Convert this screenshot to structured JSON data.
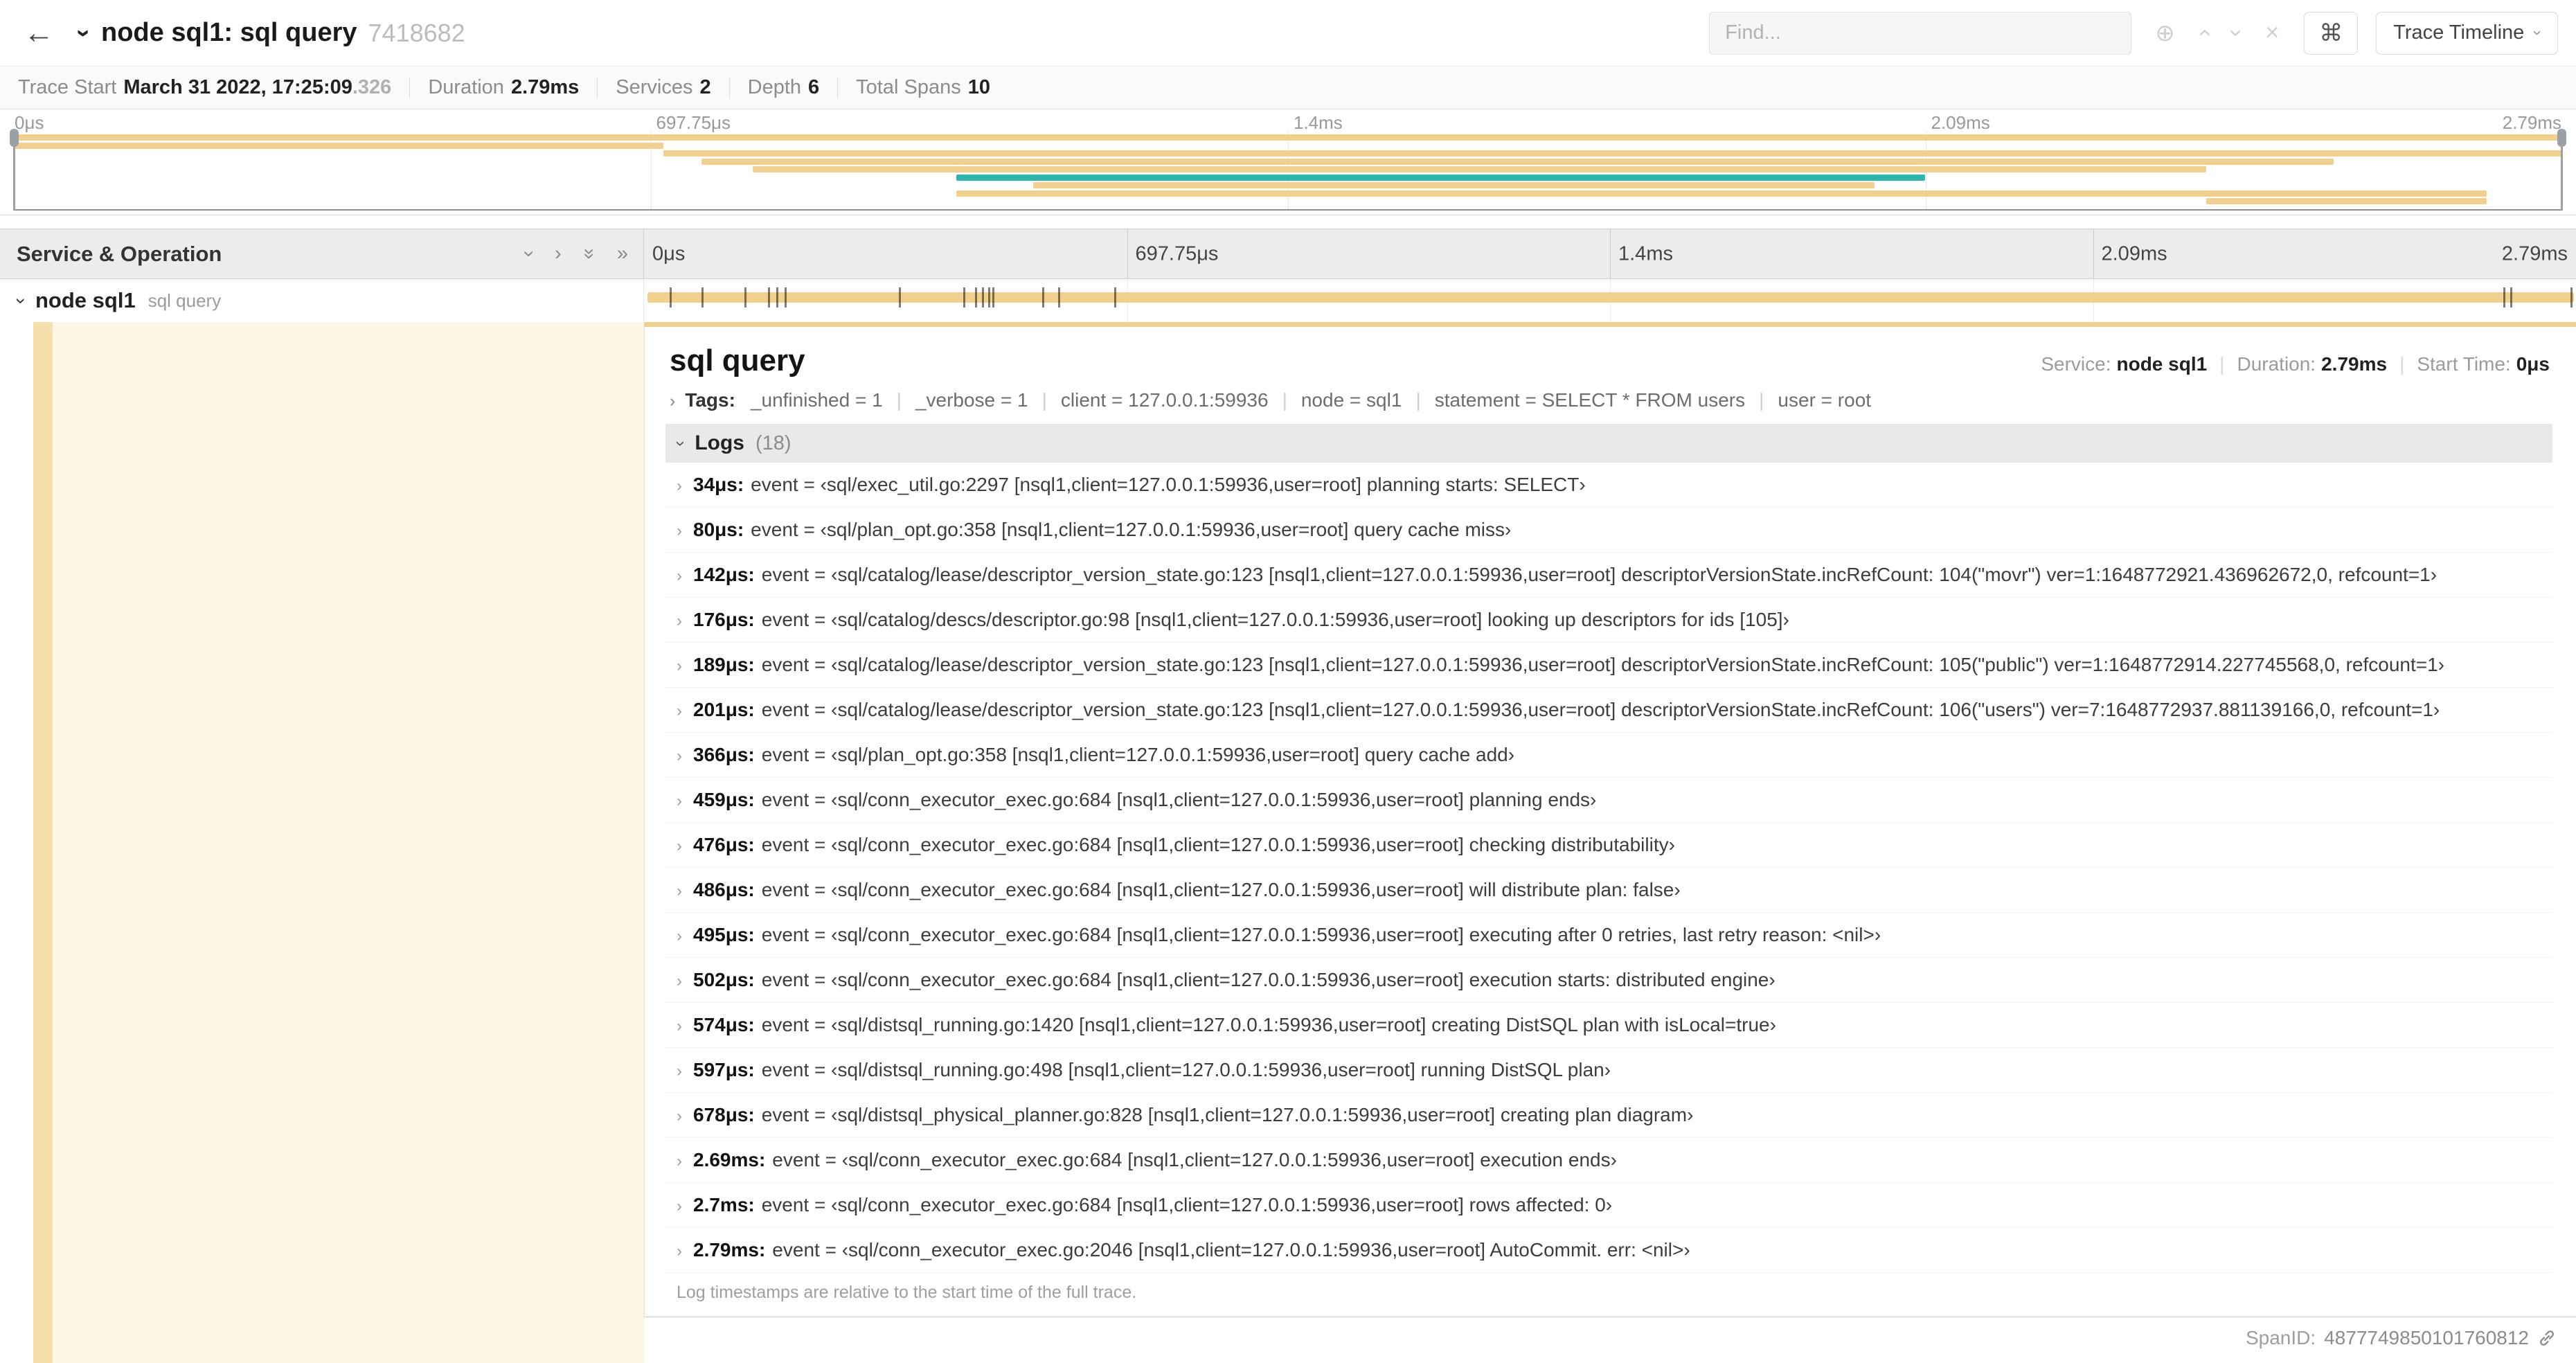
{
  "icons": {
    "back": "←",
    "chevron": "›",
    "double_chevron": "»",
    "locate": "⊕",
    "clear": "×",
    "command": "⌘"
  },
  "colors": {
    "tan": "#F0D08C",
    "tan_strip": "#F5E0AC",
    "tan_tint": "#FDF6E4",
    "teal": "#2EB6AA"
  },
  "topbar": {
    "title": "node sql1: sql query",
    "trace_id": "7418682",
    "find_placeholder": "Find...",
    "view_button": "Trace Timeline"
  },
  "infobar": {
    "items": [
      {
        "label": "Trace Start",
        "value": "March 31 2022, 17:25:09",
        "extra": ".326"
      },
      {
        "label": "Duration",
        "value": "2.79ms",
        "extra": ""
      },
      {
        "label": "Services",
        "value": "2",
        "extra": ""
      },
      {
        "label": "Depth",
        "value": "6",
        "extra": ""
      },
      {
        "label": "Total Spans",
        "value": "10",
        "extra": ""
      }
    ]
  },
  "timeline": {
    "header_left": "Service & Operation",
    "ticks": [
      {
        "label": "0μs",
        "pct": 0
      },
      {
        "label": "697.75μs",
        "pct": 25
      },
      {
        "label": "1.4ms",
        "pct": 50
      },
      {
        "label": "2.09ms",
        "pct": 75
      },
      {
        "label": "2.79ms",
        "pct": 100
      }
    ]
  },
  "minimap": {
    "spans": [
      {
        "row": 0,
        "start": 0,
        "end": 100,
        "color": "tan"
      },
      {
        "row": 1,
        "start": 0,
        "end": 25.5,
        "color": "tan"
      },
      {
        "row": 2,
        "start": 25.5,
        "end": 100,
        "color": "tan"
      },
      {
        "row": 3,
        "start": 27,
        "end": 91,
        "color": "tan"
      },
      {
        "row": 4,
        "start": 29,
        "end": 86,
        "color": "tan"
      },
      {
        "row": 5,
        "start": 37,
        "end": 75,
        "color": "teal"
      },
      {
        "row": 6,
        "start": 40,
        "end": 73,
        "color": "tan"
      },
      {
        "row": 7,
        "start": 37,
        "end": 97,
        "color": "tan"
      },
      {
        "row": 8,
        "start": 86,
        "end": 97,
        "color": "tan"
      }
    ]
  },
  "span": {
    "service": "node sql1",
    "operation": "sql query"
  },
  "detail": {
    "title": "sql query",
    "meta": {
      "service_label": "Service:",
      "service_value": "node sql1",
      "duration_label": "Duration:",
      "duration_value": "2.79ms",
      "start_label": "Start Time:",
      "start_value": "0μs"
    },
    "tags_label": "Tags:",
    "tags": [
      {
        "key": "_unfinished",
        "value": "1"
      },
      {
        "key": "_verbose",
        "value": "1"
      },
      {
        "key": "client",
        "value": "127.0.0.1:59936"
      },
      {
        "key": "node",
        "value": "sql1"
      },
      {
        "key": "statement",
        "value": "SELECT * FROM users"
      },
      {
        "key": "user",
        "value": "root"
      }
    ],
    "logs_title": "Logs",
    "logs_count": "(18)",
    "logs": [
      {
        "time": "34μs:",
        "pct": 1.22,
        "text": "event = ‹sql/exec_util.go:2297 [nsql1,client=127.0.0.1:59936,user=root] planning starts: SELECT›"
      },
      {
        "time": "80μs:",
        "pct": 2.87,
        "text": "event = ‹sql/plan_opt.go:358 [nsql1,client=127.0.0.1:59936,user=root] query cache miss›"
      },
      {
        "time": "142μs:",
        "pct": 5.09,
        "text": "event = ‹sql/catalog/lease/descriptor_version_state.go:123 [nsql1,client=127.0.0.1:59936,user=root] descriptorVersionState.incRefCount: 104(\"movr\") ver=1:1648772921.436962672,0, refcount=1›"
      },
      {
        "time": "176μs:",
        "pct": 6.31,
        "text": "event = ‹sql/catalog/descs/descriptor.go:98 [nsql1,client=127.0.0.1:59936,user=root] looking up descriptors for ids [105]›"
      },
      {
        "time": "189μs:",
        "pct": 6.77,
        "text": "event = ‹sql/catalog/lease/descriptor_version_state.go:123 [nsql1,client=127.0.0.1:59936,user=root] descriptorVersionState.incRefCount: 105(\"public\") ver=1:1648772914.227745568,0, refcount=1›"
      },
      {
        "time": "201μs:",
        "pct": 7.2,
        "text": "event = ‹sql/catalog/lease/descriptor_version_state.go:123 [nsql1,client=127.0.0.1:59936,user=root] descriptorVersionState.incRefCount: 106(\"users\") ver=7:1648772937.881139166,0, refcount=1›"
      },
      {
        "time": "366μs:",
        "pct": 13.12,
        "text": "event = ‹sql/plan_opt.go:358 [nsql1,client=127.0.0.1:59936,user=root] query cache add›"
      },
      {
        "time": "459μs:",
        "pct": 16.45,
        "text": "event = ‹sql/conn_executor_exec.go:684 [nsql1,client=127.0.0.1:59936,user=root] planning ends›"
      },
      {
        "time": "476μs:",
        "pct": 17.06,
        "text": "event = ‹sql/conn_executor_exec.go:684 [nsql1,client=127.0.0.1:59936,user=root] checking distributability›"
      },
      {
        "time": "486μs:",
        "pct": 17.42,
        "text": "event = ‹sql/conn_executor_exec.go:684 [nsql1,client=127.0.0.1:59936,user=root] will distribute plan: false›"
      },
      {
        "time": "495μs:",
        "pct": 17.74,
        "text": "event = ‹sql/conn_executor_exec.go:684 [nsql1,client=127.0.0.1:59936,user=root] executing after 0 retries, last retry reason: <nil>›"
      },
      {
        "time": "502μs:",
        "pct": 17.99,
        "text": "event = ‹sql/conn_executor_exec.go:684 [nsql1,client=127.0.0.1:59936,user=root] execution starts: distributed engine›"
      },
      {
        "time": "574μs:",
        "pct": 20.57,
        "text": "event = ‹sql/distsql_running.go:1420 [nsql1,client=127.0.0.1:59936,user=root] creating DistSQL plan with isLocal=true›"
      },
      {
        "time": "597μs:",
        "pct": 21.4,
        "text": "event = ‹sql/distsql_running.go:498 [nsql1,client=127.0.0.1:59936,user=root] running DistSQL plan›"
      },
      {
        "time": "678μs:",
        "pct": 24.3,
        "text": "event = ‹sql/distsql_physical_planner.go:828 [nsql1,client=127.0.0.1:59936,user=root] creating plan diagram›"
      },
      {
        "time": "2.69ms:",
        "pct": 96.42,
        "text": "event = ‹sql/conn_executor_exec.go:684 [nsql1,client=127.0.0.1:59936,user=root] execution ends›"
      },
      {
        "time": "2.7ms:",
        "pct": 96.77,
        "text": "event = ‹sql/conn_executor_exec.go:684 [nsql1,client=127.0.0.1:59936,user=root] rows affected: 0›"
      },
      {
        "time": "2.79ms:",
        "pct": 100,
        "text": "event = ‹sql/conn_executor_exec.go:2046 [nsql1,client=127.0.0.1:59936,user=root] AutoCommit. err: <nil>›"
      }
    ],
    "logs_footnote": "Log timestamps are relative to the start time of the full trace.",
    "spanid_label": "SpanID:",
    "spanid_value": "4877749850101760812"
  }
}
